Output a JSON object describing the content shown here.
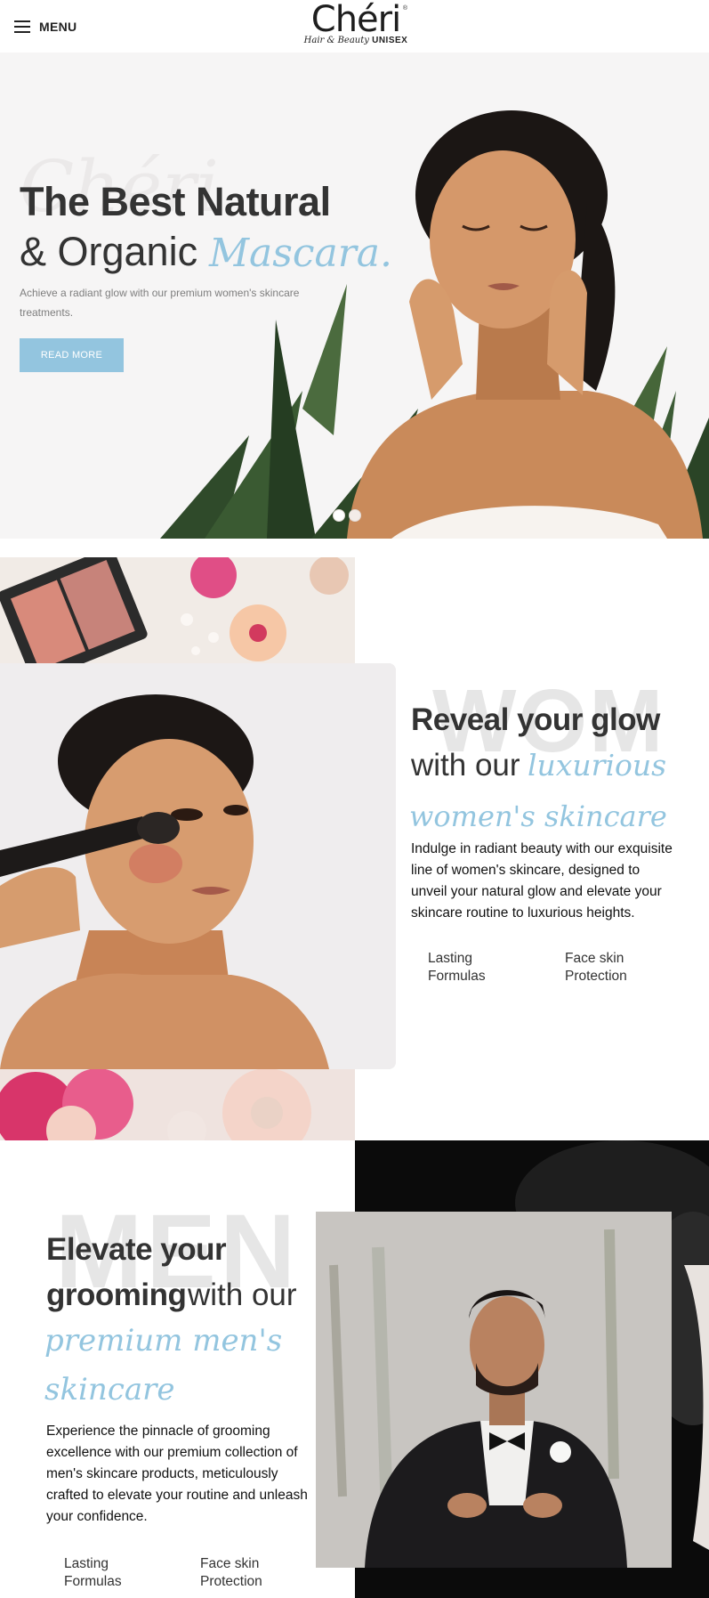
{
  "header": {
    "menu_label": "MENU",
    "logo_wordmark": "Chéri",
    "logo_registered": "®",
    "logo_tag_script": "Hair & Beauty",
    "logo_tag_bold": "UNISEX"
  },
  "hero": {
    "watermark": "Chéri",
    "title_line1": "The Best Natural",
    "title_line2": "& Organic",
    "title_script": "Mascara.",
    "subtitle": "Achieve a radiant glow with our premium women's skincare treatments.",
    "button_label": "READ MORE",
    "slides": 2,
    "active_slide": 1
  },
  "women": {
    "watermark": "WOM",
    "title_line1": "Reveal your glow",
    "title_line2": "with our",
    "script_line1": "luxurious",
    "script_line2": "women's skincare",
    "paragraph": "Indulge in radiant beauty with our exquisite line of women's skincare, designed to unveil your natural glow and elevate your skincare routine to luxurious heights.",
    "features": [
      {
        "line1": "Lasting",
        "line2": "Formulas"
      },
      {
        "line1": "Face skin",
        "line2": "Protection"
      }
    ]
  },
  "men": {
    "watermark": "MEN",
    "title_line1": "Elevate your",
    "title_line2_bold": "grooming",
    "title_line2_rest": "with our",
    "script_line1": "premium men's",
    "script_line2": "skincare",
    "paragraph": "Experience the pinnacle of grooming excellence with our premium collection of men's skincare products, meticulously crafted to elevate your routine and unleash your confidence.",
    "features": [
      {
        "line1": "Lasting",
        "line2": "Formulas"
      },
      {
        "line1": "Face skin",
        "line2": "Protection"
      }
    ]
  },
  "colors": {
    "accent": "#93c5df",
    "text": "#333333",
    "hero_bg": "#f6f5f5"
  }
}
